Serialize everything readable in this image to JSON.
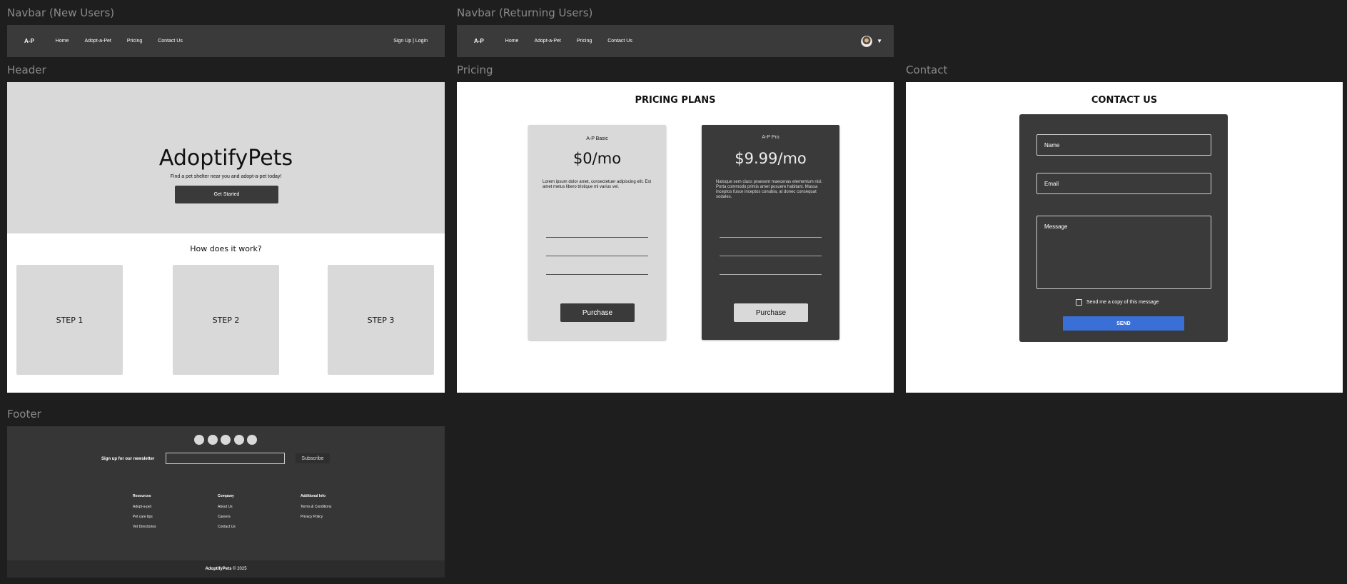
{
  "labels": {
    "navbar_new": "Navbar (New Users)",
    "navbar_returning": "Navbar (Returning Users)",
    "header": "Header",
    "pricing": "Pricing",
    "contact": "Contact",
    "footer": "Footer"
  },
  "navbar": {
    "logo": "A-P",
    "links": [
      "Home",
      "Adopt-a-Pet",
      "Pricing",
      "Contact Us"
    ],
    "signup_login": "Sign Up | Login",
    "caret": "▼"
  },
  "header": {
    "title": "AdoptifyPets",
    "subtitle": "Find a pet shelter near you and adopt-a-pet today!",
    "cta": "Get Started",
    "how_title": "How does it work?",
    "steps": [
      "STEP 1",
      "STEP 2",
      "STEP 3"
    ]
  },
  "pricing": {
    "title": "PRICING PLANS",
    "plans": [
      {
        "name": "A-P Basic",
        "price": "$0/mo",
        "description": "Lorem ipsum dolor amet, consectetuer adipiscing elit. Est amet metus libero tristique mi varius vel.",
        "button": "Purchase"
      },
      {
        "name": "A-P Pro",
        "price": "$9.99/mo",
        "description": "Natoque sem class praesent maecenas elementum nisl. Porta commodo primis amet posuere habitant. Massa inceptos fusce inceptos conubia, at donec consequat sodales.",
        "button": "Purchase"
      }
    ]
  },
  "contact": {
    "title": "CONTACT US",
    "name_placeholder": "Name",
    "email_placeholder": "Email",
    "message_placeholder": "Message",
    "copy_label": "Send me a copy of this message",
    "send": "SEND"
  },
  "footer": {
    "newsletter_label": "Sign up for our newsletter",
    "subscribe": "Subscribe",
    "columns": [
      {
        "title": "Resources",
        "links": [
          "Adopt-a-pet",
          "Pet care tips",
          "Vet Directories"
        ]
      },
      {
        "title": "Company",
        "links": [
          "About Us",
          "Careers",
          "Contact Us"
        ]
      },
      {
        "title": "Additional Info",
        "links": [
          "Terms & Conditions",
          "Privacy Policy"
        ]
      }
    ],
    "brand": "AdoptifyPets",
    "copyright": "© 2025"
  },
  "colors": {
    "canvas": "#1e1e1e",
    "navbar": "#3a3a3a",
    "light_gray": "#d9d9d9",
    "send_button": "#3a6fd8"
  }
}
